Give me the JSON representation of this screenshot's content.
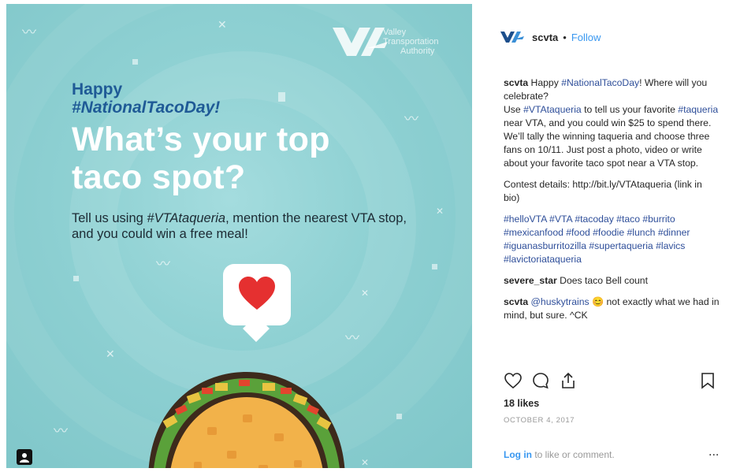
{
  "image": {
    "watermark_lines": [
      "Valley",
      "Transportation",
      "Authority"
    ],
    "happy": "Happy",
    "hashtag": "#NationalTacoDay!",
    "headline": "What’s your top taco spot?",
    "sub_prefix": "Tell us using ",
    "sub_tag": "#VTAtaqueria",
    "sub_suffix": ", mention the nearest VTA stop, and you could win a free meal!",
    "icons": {
      "heart": "heart-icon",
      "taco": "taco-illustration",
      "corner": "tag-people-icon"
    },
    "colors": {
      "background": "#8fd1d3",
      "hashtag_blue": "#1f5a96",
      "heart_red": "#e53030"
    }
  },
  "header": {
    "handle": "scvta",
    "separator": "•",
    "follow": "Follow"
  },
  "caption": {
    "handle": "scvta",
    "line1_a": " Happy ",
    "line1_tag": "#NationalTacoDay",
    "line1_b": "! Where will you celebrate?",
    "line2_a": "Use ",
    "line2_tag": "#VTAtaqueria",
    "line2_b": " to tell us your favorite ",
    "line2_tag2": "#taqueria",
    "line2_c": " near VTA, and you could win $25 to spend there. We’ll tally the winning taqueria and choose three fans on 10/11. Just post a photo, video or write about your favorite taco spot near a VTA stop.",
    "contest": "Contest details: http://bit.ly/VTAtaqueria (link in bio)",
    "hashtags": "#helloVTA #VTA #tacoday #taco #burrito #mexicanfood #food #foodie #lunch #dinner #iguanasburritozilla #supertaqueria #lavics #lavictoriataqueria"
  },
  "comments": [
    {
      "user": "severe_star",
      "text": " Does taco Bell count"
    },
    {
      "user": "scvta",
      "mention": " @huskytrains",
      "emoji": " 😊",
      "text": " not exactly what we had in mind, but sure. ^CK"
    }
  ],
  "actions": {
    "like_icon": "heart-outline-icon",
    "comment_icon": "comment-icon",
    "share_icon": "share-icon",
    "save_icon": "bookmark-icon"
  },
  "likes": "18 likes",
  "date": "OCTOBER 4, 2017",
  "login": {
    "link": "Log in",
    "rest": " to like or comment."
  },
  "more": "..."
}
